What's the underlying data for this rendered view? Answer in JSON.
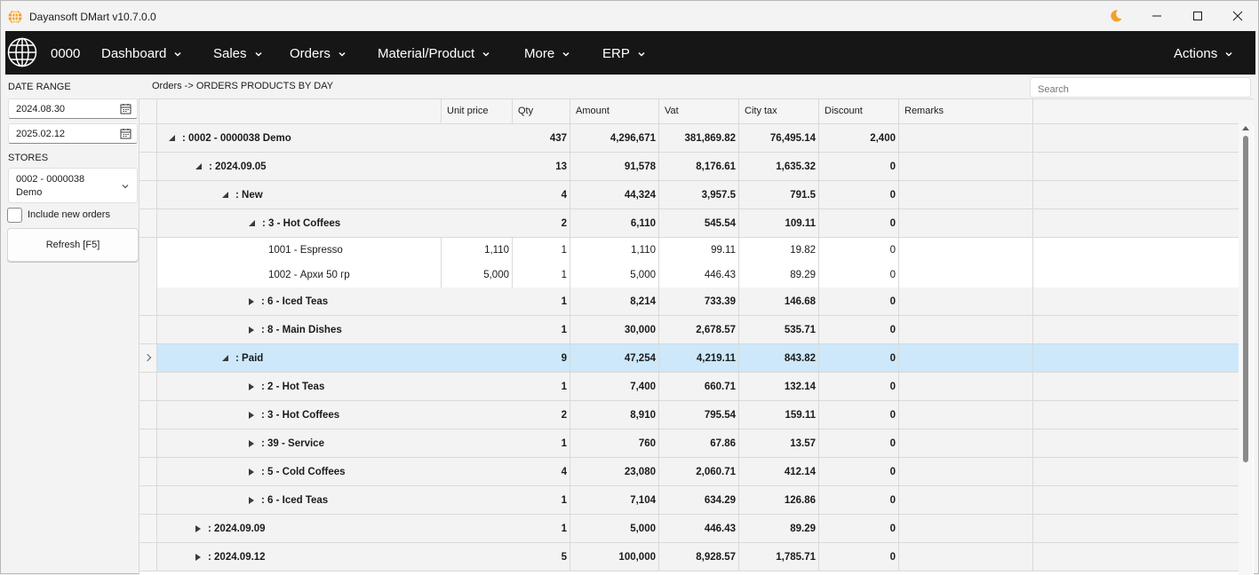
{
  "window": {
    "title": "Dayansoft DMart v10.7.0.0"
  },
  "navbar": {
    "code": "0000",
    "items": [
      "Dashboard",
      "Sales",
      "Orders",
      "Material/Product",
      "More",
      "ERP"
    ],
    "actions_label": "Actions"
  },
  "sidebar": {
    "date_range_label": "DATE RANGE",
    "date_from": "2024.08.30",
    "date_to": "2025.02.12",
    "stores_label": "STORES",
    "store_line1": "0002 - 0000038",
    "store_line2": "Demo",
    "include_new_orders_label": "Include new orders",
    "refresh_label": "Refresh [F5]"
  },
  "breadcrumb": "Orders -> ORDERS PRODUCTS BY DAY",
  "search": {
    "placeholder": "Search"
  },
  "grid": {
    "columns": [
      "Unit price",
      "Qty",
      "Amount",
      "Vat",
      "City tax",
      "Discount",
      "Remarks"
    ],
    "rows": [
      {
        "level": 0,
        "name": ": 0002 - 0000038 Demo",
        "expanded": true,
        "type": "group",
        "unit_price": "",
        "qty": "437",
        "amount": "4,296,671",
        "vat": "381,869.82",
        "city_tax": "76,495.14",
        "discount": "2,400"
      },
      {
        "level": 1,
        "name": ": 2024.09.05",
        "expanded": true,
        "type": "group",
        "unit_price": "",
        "qty": "13",
        "amount": "91,578",
        "vat": "8,176.61",
        "city_tax": "1,635.32",
        "discount": "0"
      },
      {
        "level": 2,
        "name": ": New",
        "expanded": true,
        "type": "group",
        "unit_price": "",
        "qty": "4",
        "amount": "44,324",
        "vat": "3,957.5",
        "city_tax": "791.5",
        "discount": "0"
      },
      {
        "level": 3,
        "name": ": 3 - Hot Coffees",
        "expanded": true,
        "type": "group",
        "unit_price": "",
        "qty": "2",
        "amount": "6,110",
        "vat": "545.54",
        "city_tax": "109.11",
        "discount": "0"
      },
      {
        "level": 4,
        "name": "1001 - Espresso",
        "type": "detail",
        "unit_price": "1,110",
        "qty": "1",
        "amount": "1,110",
        "vat": "99.11",
        "city_tax": "19.82",
        "discount": "0"
      },
      {
        "level": 4,
        "name": "1002 - Архи 50 гр",
        "type": "detail",
        "unit_price": "5,000",
        "qty": "1",
        "amount": "5,000",
        "vat": "446.43",
        "city_tax": "89.29",
        "discount": "0"
      },
      {
        "level": 3,
        "name": ": 6 - Iced Teas",
        "expanded": false,
        "type": "group",
        "unit_price": "",
        "qty": "1",
        "amount": "8,214",
        "vat": "733.39",
        "city_tax": "146.68",
        "discount": "0"
      },
      {
        "level": 3,
        "name": ": 8 - Main Dishes",
        "expanded": false,
        "type": "group",
        "unit_price": "",
        "qty": "1",
        "amount": "30,000",
        "vat": "2,678.57",
        "city_tax": "535.71",
        "discount": "0"
      },
      {
        "level": 2,
        "name": ": Paid",
        "expanded": true,
        "type": "group",
        "selected": true,
        "unit_price": "",
        "qty": "9",
        "amount": "47,254",
        "vat": "4,219.11",
        "city_tax": "843.82",
        "discount": "0"
      },
      {
        "level": 3,
        "name": ": 2 - Hot Teas",
        "expanded": false,
        "type": "group",
        "unit_price": "",
        "qty": "1",
        "amount": "7,400",
        "vat": "660.71",
        "city_tax": "132.14",
        "discount": "0"
      },
      {
        "level": 3,
        "name": ": 3 - Hot Coffees",
        "expanded": false,
        "type": "group",
        "unit_price": "",
        "qty": "2",
        "amount": "8,910",
        "vat": "795.54",
        "city_tax": "159.11",
        "discount": "0"
      },
      {
        "level": 3,
        "name": ": 39 - Service",
        "expanded": false,
        "type": "group",
        "unit_price": "",
        "qty": "1",
        "amount": "760",
        "vat": "67.86",
        "city_tax": "13.57",
        "discount": "0"
      },
      {
        "level": 3,
        "name": ": 5 - Cold Coffees",
        "expanded": false,
        "type": "group",
        "unit_price": "",
        "qty": "4",
        "amount": "23,080",
        "vat": "2,060.71",
        "city_tax": "412.14",
        "discount": "0"
      },
      {
        "level": 3,
        "name": ": 6 - Iced Teas",
        "expanded": false,
        "type": "group",
        "unit_price": "",
        "qty": "1",
        "amount": "7,104",
        "vat": "634.29",
        "city_tax": "126.86",
        "discount": "0"
      },
      {
        "level": 1,
        "name": ": 2024.09.09",
        "expanded": false,
        "type": "group",
        "unit_price": "",
        "qty": "1",
        "amount": "5,000",
        "vat": "446.43",
        "city_tax": "89.29",
        "discount": "0"
      },
      {
        "level": 1,
        "name": ": 2024.09.12",
        "expanded": false,
        "type": "group",
        "unit_price": "",
        "qty": "5",
        "amount": "100,000",
        "vat": "8,928.57",
        "city_tax": "1,785.71",
        "discount": "0"
      }
    ]
  },
  "icons": {
    "app": "globe-icon",
    "theme": "moon-icon",
    "minimize": "minimize-icon",
    "maximize": "maximize-icon",
    "close": "close-icon"
  },
  "colors": {
    "navbar_bg": "#161616",
    "selected_row": "#cce8fa",
    "group_row": "#f3f3f3",
    "moon": "#f0a030"
  }
}
